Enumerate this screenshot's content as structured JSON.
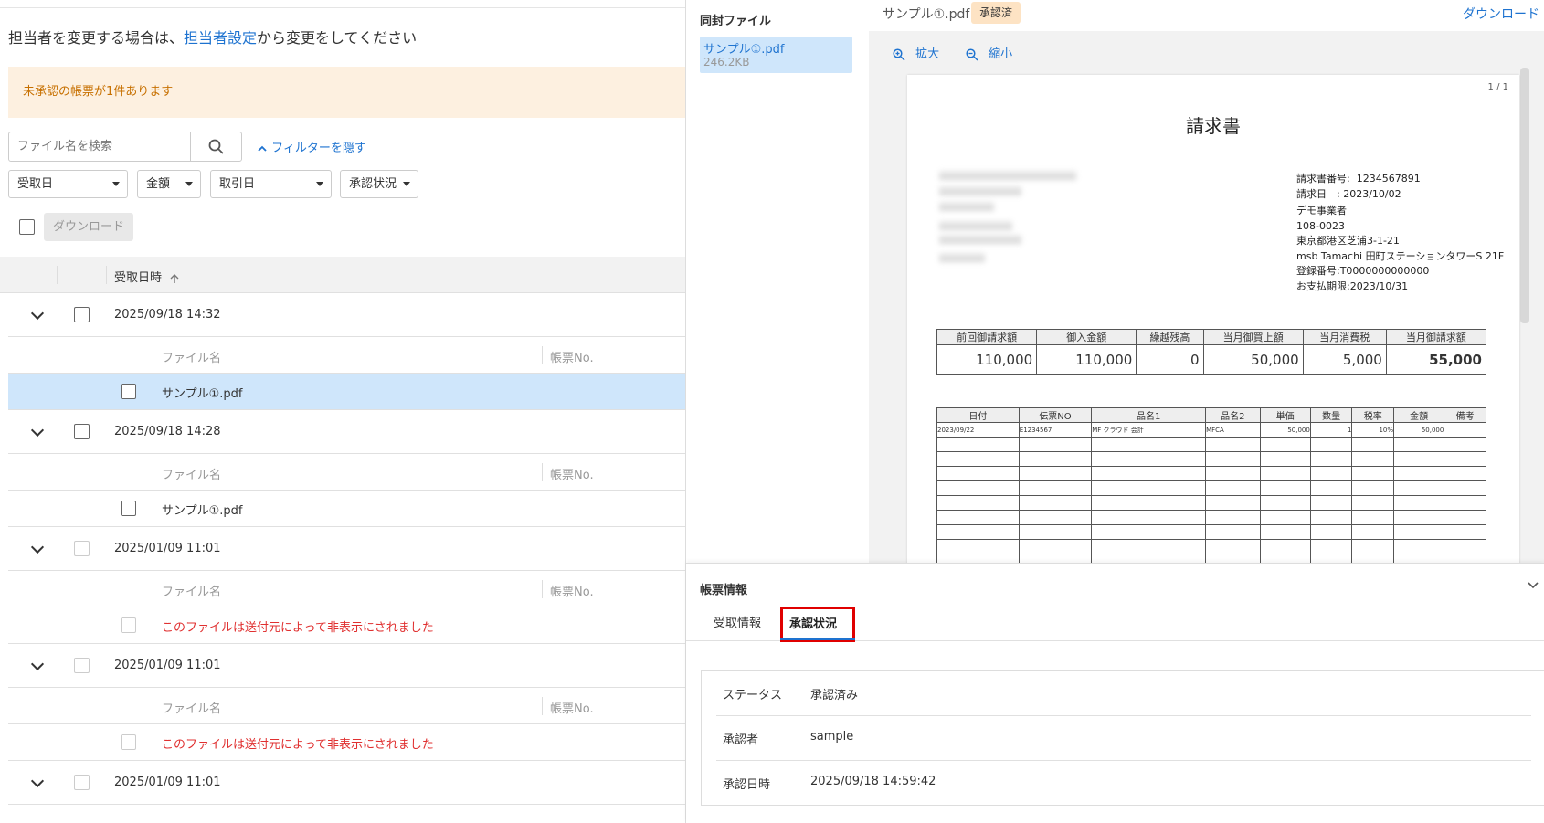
{
  "left": {
    "assign_prefix": "担当者を変更する場合は、",
    "assign_link": "担当者設定",
    "assign_suffix": "から変更をしてください",
    "notice": "未承認の帳票が1件あります",
    "search_placeholder": "ファイル名を検索",
    "filter_toggle": "フィルターを隠す",
    "filters": [
      "受取日",
      "金額",
      "取引日",
      "承認状況"
    ],
    "download_button": "ダウンロード",
    "column_received": "受取日時",
    "col_filename": "ファイル名",
    "col_doc_no": "帳票No.",
    "groups": [
      {
        "datetime": "2025/09/18 14:32",
        "file": "サンプル①.pdf"
      },
      {
        "datetime": "2025/09/18 14:28",
        "file": "サンプル①.pdf"
      },
      {
        "datetime": "2025/01/09 11:01",
        "file": "このファイルは送付元によって非表示にされました"
      },
      {
        "datetime": "2025/01/09 11:01",
        "file": "このファイルは送付元によって非表示にされました"
      },
      {
        "datetime": "2025/01/09 11:01"
      }
    ]
  },
  "right": {
    "files_heading": "同封ファイル",
    "file_name": "サンプル①.pdf",
    "file_size": "246.2KB",
    "header_file": "サンプル①.pdf",
    "header_badge": "承認済",
    "download_link": "ダウンロード",
    "zoom_in": "拡大",
    "zoom_out": "縮小",
    "page_counter": "1 / 1",
    "invoice": {
      "title": "請求書",
      "no_label": "請求書番号:",
      "no_value": "1234567891",
      "date_label": "請求日　:",
      "date_value": "2023/10/02",
      "issuer": "デモ事業者",
      "zip": "108-0023",
      "addr1": "東京都港区芝浦3-1-21",
      "addr2": "msb Tamachi 田町ステーションタワーS 21F",
      "reg": "登録番号:T0000000000000",
      "due": "お支払期限:2023/10/31",
      "sum_headers": [
        "前回御請求額",
        "御入金額",
        "繰越残高",
        "当月御買上額",
        "当月消費税",
        "当月御請求額"
      ],
      "sum_values": [
        "110,000",
        "110,000",
        "0",
        "50,000",
        "5,000",
        "55,000"
      ],
      "det_headers": [
        "日付",
        "伝票NO",
        "品名1",
        "品名2",
        "単価",
        "数量",
        "税率",
        "金額",
        "備考"
      ],
      "det_row": [
        "2023/09/22",
        "E1234567",
        "MF クラウド 会計",
        "MFCA",
        "50,000",
        "1",
        "10%",
        "50,000",
        ""
      ]
    },
    "info_heading": "帳票情報",
    "tabs": [
      "受取情報",
      "承認状況"
    ],
    "status_rows": [
      {
        "label": "ステータス",
        "value": "承認済み"
      },
      {
        "label": "承認者",
        "value": "sample"
      },
      {
        "label": "承認日時",
        "value": "2025/09/18 14:59:42"
      }
    ]
  },
  "colors": {
    "accent": "#1e73d0",
    "badge_bg": "#fde3c4",
    "highlight": "#e00000",
    "selected_row": "#cfe6fb"
  }
}
